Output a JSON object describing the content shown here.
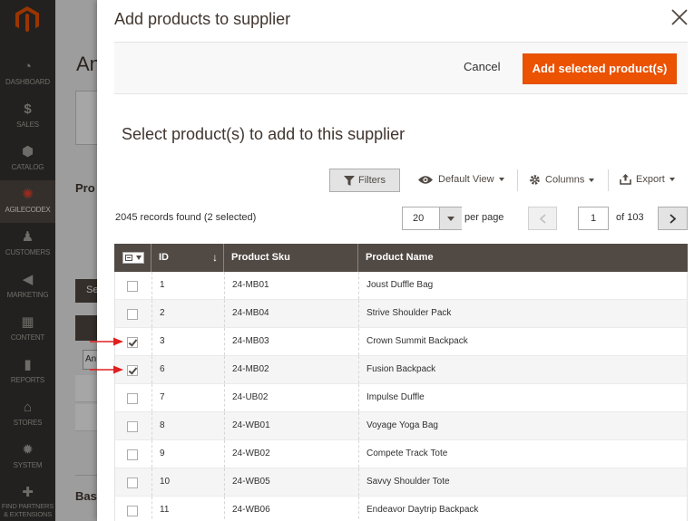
{
  "sidebar": {
    "items": [
      {
        "label": "DASHBOARD",
        "icon": "dashboard-icon",
        "glyph": "◔",
        "active": false
      },
      {
        "label": "SALES",
        "icon": "dollar-icon",
        "glyph": "$",
        "active": false
      },
      {
        "label": "CATALOG",
        "icon": "cube-icon",
        "glyph": "⬢",
        "active": false
      },
      {
        "label": "AGILECODEX",
        "icon": "agilecodex-icon",
        "glyph": "✺",
        "active": true
      },
      {
        "label": "CUSTOMERS",
        "icon": "person-icon",
        "glyph": "♟",
        "active": false
      },
      {
        "label": "MARKETING",
        "icon": "megaphone-icon",
        "glyph": "◀",
        "active": false
      },
      {
        "label": "CONTENT",
        "icon": "layout-icon",
        "glyph": "▦",
        "active": false
      },
      {
        "label": "REPORTS",
        "icon": "bar-chart-icon",
        "glyph": "▮",
        "active": false
      },
      {
        "label": "STORES",
        "icon": "store-icon",
        "glyph": "⌂",
        "active": false
      },
      {
        "label": "SYSTEM",
        "icon": "gear-icon",
        "glyph": "✹",
        "active": false
      },
      {
        "label": "FIND PARTNERS & EXTENSIONS",
        "icon": "puzzle-icon",
        "glyph": "✚",
        "active": false
      }
    ]
  },
  "background": {
    "title": "An",
    "prod_label": "Pro",
    "sel_label": "Se",
    "input_value": "An",
    "bas_label": "Bas"
  },
  "modal": {
    "title": "Add products to supplier",
    "cancel_label": "Cancel",
    "add_label": "Add selected product(s)",
    "section_title": "Select product(s) to add to this supplier"
  },
  "toolbar": {
    "filters_label": "Filters",
    "view_label": "Default View",
    "columns_label": "Columns",
    "export_label": "Export"
  },
  "pager": {
    "records_text": "2045 records found (2 selected)",
    "per_page_value": "20",
    "per_page_label": "per page",
    "current_page": "1",
    "of_text": "of 103"
  },
  "grid": {
    "columns": [
      "ID",
      "Product Sku",
      "Product Name"
    ],
    "sort_arrow": "↓",
    "rows": [
      {
        "id": "1",
        "sku": "24-MB01",
        "name": "Joust Duffle Bag",
        "checked": false
      },
      {
        "id": "2",
        "sku": "24-MB04",
        "name": "Strive Shoulder Pack",
        "checked": false
      },
      {
        "id": "3",
        "sku": "24-MB03",
        "name": "Crown Summit Backpack",
        "checked": true
      },
      {
        "id": "6",
        "sku": "24-MB02",
        "name": "Fusion Backpack",
        "checked": true
      },
      {
        "id": "7",
        "sku": "24-UB02",
        "name": "Impulse Duffle",
        "checked": false
      },
      {
        "id": "8",
        "sku": "24-WB01",
        "name": "Voyage Yoga Bag",
        "checked": false
      },
      {
        "id": "9",
        "sku": "24-WB02",
        "name": "Compete Track Tote",
        "checked": false
      },
      {
        "id": "10",
        "sku": "24-WB05",
        "name": "Savvy Shoulder Tote",
        "checked": false
      },
      {
        "id": "11",
        "sku": "24-WB06",
        "name": "Endeavor Daytrip Backpack",
        "checked": false
      }
    ]
  },
  "colors": {
    "accent": "#eb5202",
    "header_bg": "#514943",
    "sidebar_bg": "#373330",
    "annotation_arrow": "#e02020"
  }
}
